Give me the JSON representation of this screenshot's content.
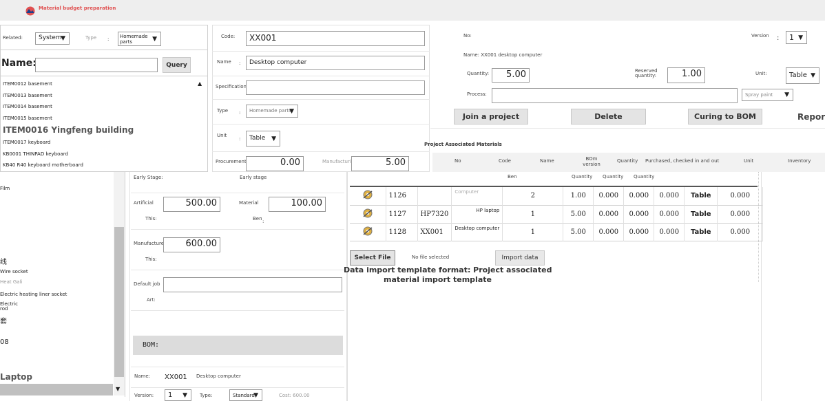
{
  "app": {
    "title": "Material budget preparation"
  },
  "left_panel": {
    "related_label": "Related:",
    "related_value": "System",
    "type_label": "Type",
    "type_value": "Homemade parts",
    "name_label": "Name:",
    "query_button": "Query",
    "list_items": [
      "ITEM0012 basement",
      "ITEM0013 basement",
      "ITEM0014 basement",
      "ITEM0015 basement",
      "ITEM0016 Yingfeng building",
      "ITEM0017 keyboard",
      "KB0001 THINPAD keyboard",
      "KB40 R40 keyboard motherboard"
    ],
    "lower_list": [
      "Film",
      "线",
      "Wire socket",
      "Heat Gali",
      "Electric heating liner socket",
      "Electric",
      "rod",
      "套",
      "08",
      "Laptop"
    ]
  },
  "middle_panel": {
    "code_label": "Code:",
    "code_value": "XX001",
    "name_label": "Name",
    "name_value": "Desktop computer",
    "spec_label": "Specifications",
    "spec_value": "",
    "type_label": "Type",
    "type_value": "Homemade parts",
    "unit_label": "Unit",
    "unit_value": "Table",
    "procurement_label": "Procurement",
    "procurement_value": "0.00",
    "manufacturing_lift_label": "Manufacturing lift",
    "manufacturing_lift_value": "5.00",
    "early_stage_label": "Early Stage:",
    "early_stage_right": "Early stage",
    "artificial_label": "Artificial",
    "artificial_value": "500.00",
    "material_label": "Material",
    "material_value": "100.00",
    "this_label": "This:",
    "ben_label": "Ben",
    "manufactured_label": "Manufactured",
    "manufactured_value": "600.00",
    "this_label2": "This:",
    "default_job_label": "Default job",
    "art_label": "Art:",
    "bom_label": "BOM:",
    "bom_name_label": "Name:",
    "bom_name_code": "XX001",
    "bom_name_text": "Desktop computer",
    "version_label": "Version:",
    "version_value": "1",
    "type_label2": "Type:",
    "type_value2": "Standard",
    "cost_label": "Cost: 600.00"
  },
  "right_panel": {
    "no_label": "No:",
    "version_label": "Version",
    "version_value": "1",
    "name_line": "Name: XX001 desktop computer",
    "quantity_label": "Quantity:",
    "quantity_value": "5.00",
    "reserved_label": "Reserved quantity:",
    "reserved_value": "1.00",
    "unit_label": "Unit:",
    "unit_value": "Table",
    "process_label": "Process:",
    "process_select": "Spray paint",
    "buttons": {
      "join": "Join a project",
      "delete": "Delete",
      "curing": "Curing to BOM",
      "report": "Report"
    },
    "section_title": "Project Associated Materials",
    "table_headers": [
      "No",
      "Code",
      "Name",
      "BOm version",
      "Quantity",
      "Purchased, checked in and out",
      "Unit",
      "Inventory"
    ],
    "sub_headers": [
      "Ben",
      "Quantity",
      "Quantity",
      "Quantity"
    ],
    "rows": [
      {
        "no": "1126",
        "code": "",
        "name": "Computer",
        "bom": "2",
        "qty": "1.00",
        "p1": "0.000",
        "p2": "0.000",
        "p3": "0.000",
        "unit": "Table",
        "inv": "0.000"
      },
      {
        "no": "1127",
        "code": "HP7320",
        "name": "HP laptop",
        "bom": "1",
        "qty": "5.00",
        "p1": "0.000",
        "p2": "0.000",
        "p3": "0.000",
        "unit": "Table",
        "inv": "0.000"
      },
      {
        "no": "1128",
        "code": "XX001",
        "name": "Desktop computer",
        "bom": "1",
        "qty": "5.00",
        "p1": "0.000",
        "p2": "0.000",
        "p3": "0.000",
        "unit": "Table",
        "inv": "0.000"
      }
    ],
    "select_file": "Select File",
    "no_file": "No file selected",
    "import_data": "Import data",
    "template_line1": "Data import template format: Project associated",
    "template_line2": "material import template"
  },
  "colors": {
    "topbar": "#eeeeee",
    "accent": "#e05050",
    "bom_bar": "#dcdcdc",
    "scroll": "#c0c0c0"
  }
}
